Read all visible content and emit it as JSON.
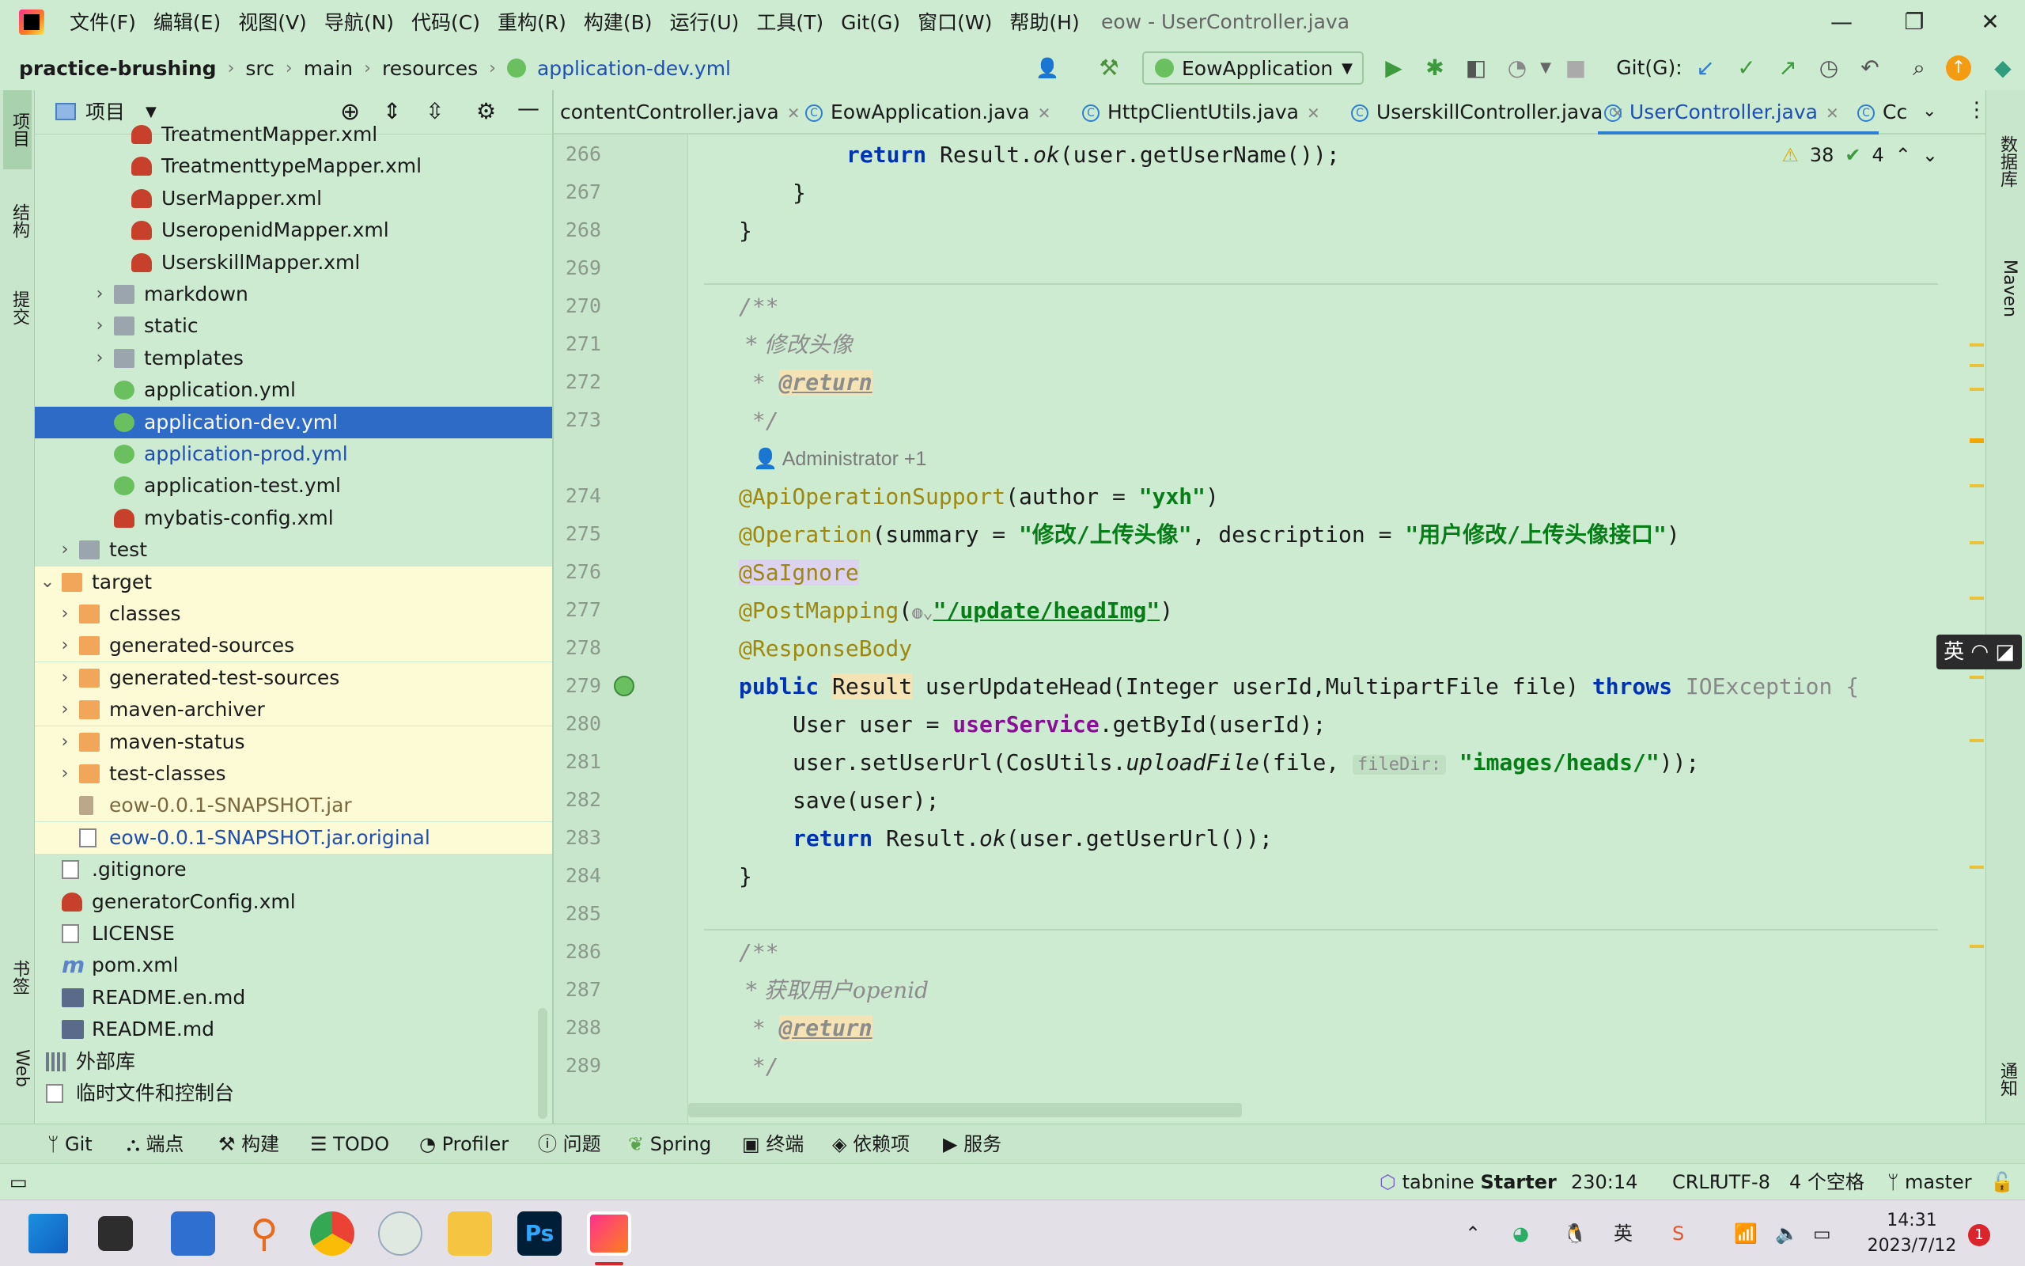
{
  "menu": [
    "文件(F)",
    "编辑(E)",
    "视图(V)",
    "导航(N)",
    "代码(C)",
    "重构(R)",
    "构建(B)",
    "运行(U)",
    "工具(T)",
    "Git(G)",
    "窗口(W)",
    "帮助(H)"
  ],
  "window_title": "eow - UserController.java",
  "breadcrumb": {
    "project": "practice-brushing",
    "p1": "src",
    "p2": "main",
    "p3": "resources",
    "file": "application-dev.yml"
  },
  "run_config": "EowApplication",
  "git_label": "Git(G):",
  "project_panel": {
    "title": "项目"
  },
  "tree": [
    {
      "label": "TreatmentMapper.xml",
      "icon": "xml"
    },
    {
      "label": "TreatmenttypeMapper.xml",
      "icon": "xml"
    },
    {
      "label": "UserMapper.xml",
      "icon": "xml"
    },
    {
      "label": "UseropenidMapper.xml",
      "icon": "xml"
    },
    {
      "label": "UserskillMapper.xml",
      "icon": "xml"
    },
    {
      "label": "markdown",
      "icon": "gfolder"
    },
    {
      "label": "static",
      "icon": "gfolder"
    },
    {
      "label": "templates",
      "icon": "gfolder"
    },
    {
      "label": "application.yml",
      "icon": "yml"
    },
    {
      "label": "application-dev.yml",
      "icon": "yml"
    },
    {
      "label": "application-prod.yml",
      "icon": "yml"
    },
    {
      "label": "application-test.yml",
      "icon": "yml"
    },
    {
      "label": "mybatis-config.xml",
      "icon": "xml"
    },
    {
      "label": "test",
      "icon": "gfolder"
    },
    {
      "label": "target",
      "icon": "folder"
    },
    {
      "label": "classes",
      "icon": "folder"
    },
    {
      "label": "generated-sources",
      "icon": "folder"
    },
    {
      "label": "generated-test-sources",
      "icon": "folder"
    },
    {
      "label": "maven-archiver",
      "icon": "folder"
    },
    {
      "label": "maven-status",
      "icon": "folder"
    },
    {
      "label": "test-classes",
      "icon": "folder"
    },
    {
      "label": "eow-0.0.1-SNAPSHOT.jar",
      "icon": "jar"
    },
    {
      "label": "eow-0.0.1-SNAPSHOT.jar.original",
      "icon": "doc"
    },
    {
      "label": ".gitignore",
      "icon": "doc"
    },
    {
      "label": "generatorConfig.xml",
      "icon": "xml"
    },
    {
      "label": "LICENSE",
      "icon": "doc"
    },
    {
      "label": "pom.xml",
      "icon": "mvn"
    },
    {
      "label": "README.en.md",
      "icon": "md"
    },
    {
      "label": "README.md",
      "icon": "md"
    },
    {
      "label": "外部库",
      "icon": "lib"
    },
    {
      "label": "临时文件和控制台",
      "icon": "doc"
    }
  ],
  "tabs": [
    "contentController.java",
    "EowApplication.java",
    "HttpClientUtils.java",
    "UserskillController.java",
    "UserController.java",
    "Cc"
  ],
  "inspections": {
    "warnings": "38",
    "ok": "4"
  },
  "line_numbers": [
    "266",
    "267",
    "268",
    "269",
    "270",
    "271",
    "272",
    "273",
    "274",
    "275",
    "276",
    "277",
    "278",
    "279",
    "280",
    "281",
    "282",
    "283",
    "284",
    "285",
    "286",
    "287",
    "288",
    "289"
  ],
  "code": {
    "l266a": "return",
    "l266b": " Result.",
    "l266c": "ok",
    "l266d": "(user.getUserName());",
    "l267": "}",
    "l268": "}",
    "l270": "/**",
    "l271": " * 修改头像",
    "l272a": " * ",
    "l272b": "@return",
    "l273": " */",
    "author": "Administrator +1",
    "l274a": "@ApiOperationSupport",
    "l274b": "(author = ",
    "l274c": "\"yxh\"",
    "l274d": ")",
    "l275a": "@Operation",
    "l275b": "(summary = ",
    "l275c": "\"修改/上传头像\"",
    "l275d": ", description = ",
    "l275e": "\"用户修改/上传头像接口\"",
    "l275f": ")",
    "l276": "@SaIgnore",
    "l277a": "@PostMapping",
    "l277b": "(",
    "l277c": "\"/update/headImg\"",
    "l277d": ")",
    "l278": "@ResponseBody",
    "l279a": "public",
    "l279b": "Result",
    "l279c": " userUpdateHead(Integer userId,MultipartFile file) ",
    "l279d": "throws",
    "l279e": " IOException {",
    "l280a": "User user = ",
    "l280b": "userService",
    "l280c": ".getById(userId);",
    "l281a": "user.setUserUrl(CosUtils.",
    "l281b": "uploadFile",
    "l281c": "(file, ",
    "l281hint": "fileDir:",
    "l281d": " \"images/heads/\"",
    "l281e": "));",
    "l282": "save(user);",
    "l283a": "return",
    "l283b": " Result.",
    "l283c": "ok",
    "l283d": "(user.getUserUrl());",
    "l284": "}",
    "l286": "/**",
    "l287": " * 获取用户openid",
    "l288a": " * ",
    "l288b": "@return",
    "l289": " */"
  },
  "left_strip": [
    "项目",
    "结构",
    "提交",
    "书签",
    "Web"
  ],
  "right_strip": [
    "数据库",
    "Maven",
    "通知"
  ],
  "tool_windows": [
    "Git",
    "端点",
    "构建",
    "TODO",
    "Profiler",
    "问题",
    "Spring",
    "终端",
    "依赖项",
    "服务"
  ],
  "status": {
    "tabnine": "tabnine",
    "tabnine_plan": "Starter",
    "position": "230:14",
    "line_sep": "CRLF",
    "encoding": "UTF-8",
    "indent": "4 个空格",
    "branch": "master"
  },
  "ime": "英",
  "taskbar": {
    "tray_ime": "英",
    "time": "14:31",
    "date": "2023/7/12",
    "notifications": "1"
  }
}
